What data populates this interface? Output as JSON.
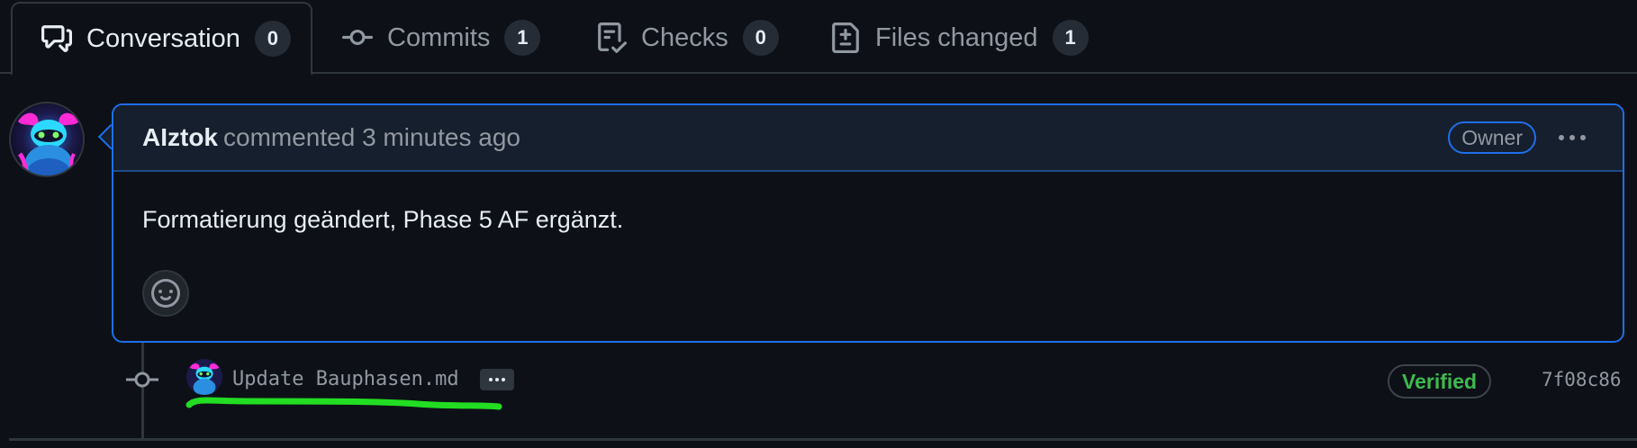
{
  "tabs": [
    {
      "label": "Conversation",
      "count": "0",
      "icon": "comment-discussion-icon",
      "active": true
    },
    {
      "label": "Commits",
      "count": "1",
      "icon": "git-commit-icon"
    },
    {
      "label": "Checks",
      "count": "0",
      "icon": "checklist-icon"
    },
    {
      "label": "Files changed",
      "count": "1",
      "icon": "file-diff-icon"
    }
  ],
  "comment": {
    "author": "AIztok",
    "action": "commented 3 minutes ago",
    "role_badge": "Owner",
    "body": "Formatierung geändert, Phase 5 AF ergänzt.",
    "menu_icon": "kebab-horizontal-icon",
    "reaction_icon": "smiley-icon"
  },
  "commit": {
    "message": "Update Bauphasen.md",
    "verified_label": "Verified",
    "sha": "7f08c86",
    "icon": "git-commit-icon"
  },
  "colors": {
    "background": "#0d1117",
    "accent_border": "#1f6feb",
    "verified_green": "#3fb950",
    "highlight_green": "#22dd22"
  }
}
